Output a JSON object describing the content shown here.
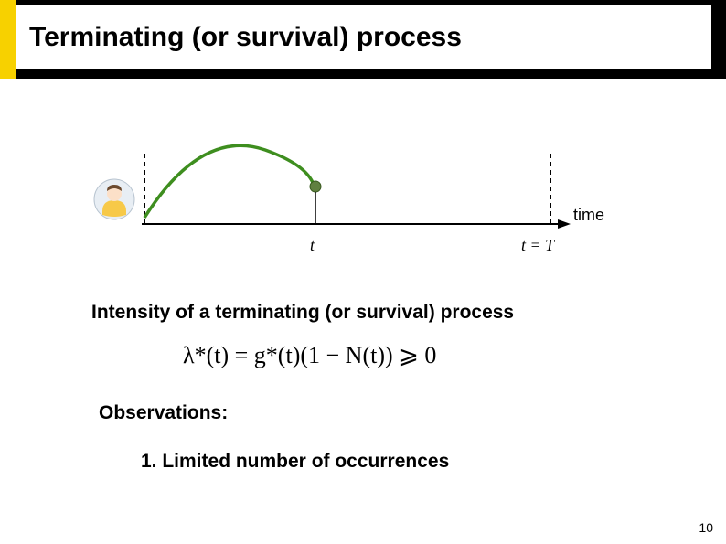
{
  "header": {
    "title": "Terminating (or survival) process"
  },
  "diagram": {
    "time_label": "time",
    "tick_t": "t",
    "tick_T": "t = T"
  },
  "content": {
    "intensity_heading": "Intensity of a terminating (or survival) process",
    "formula": "λ*(t) = g*(t)(1 − N(t)) ⩾ 0",
    "observations_heading": "Observations:",
    "obs1": "1.   Limited number of occurrences"
  },
  "page_number": "10",
  "colors": {
    "accent": "#f7d100",
    "curve": "#3e8e1f"
  }
}
